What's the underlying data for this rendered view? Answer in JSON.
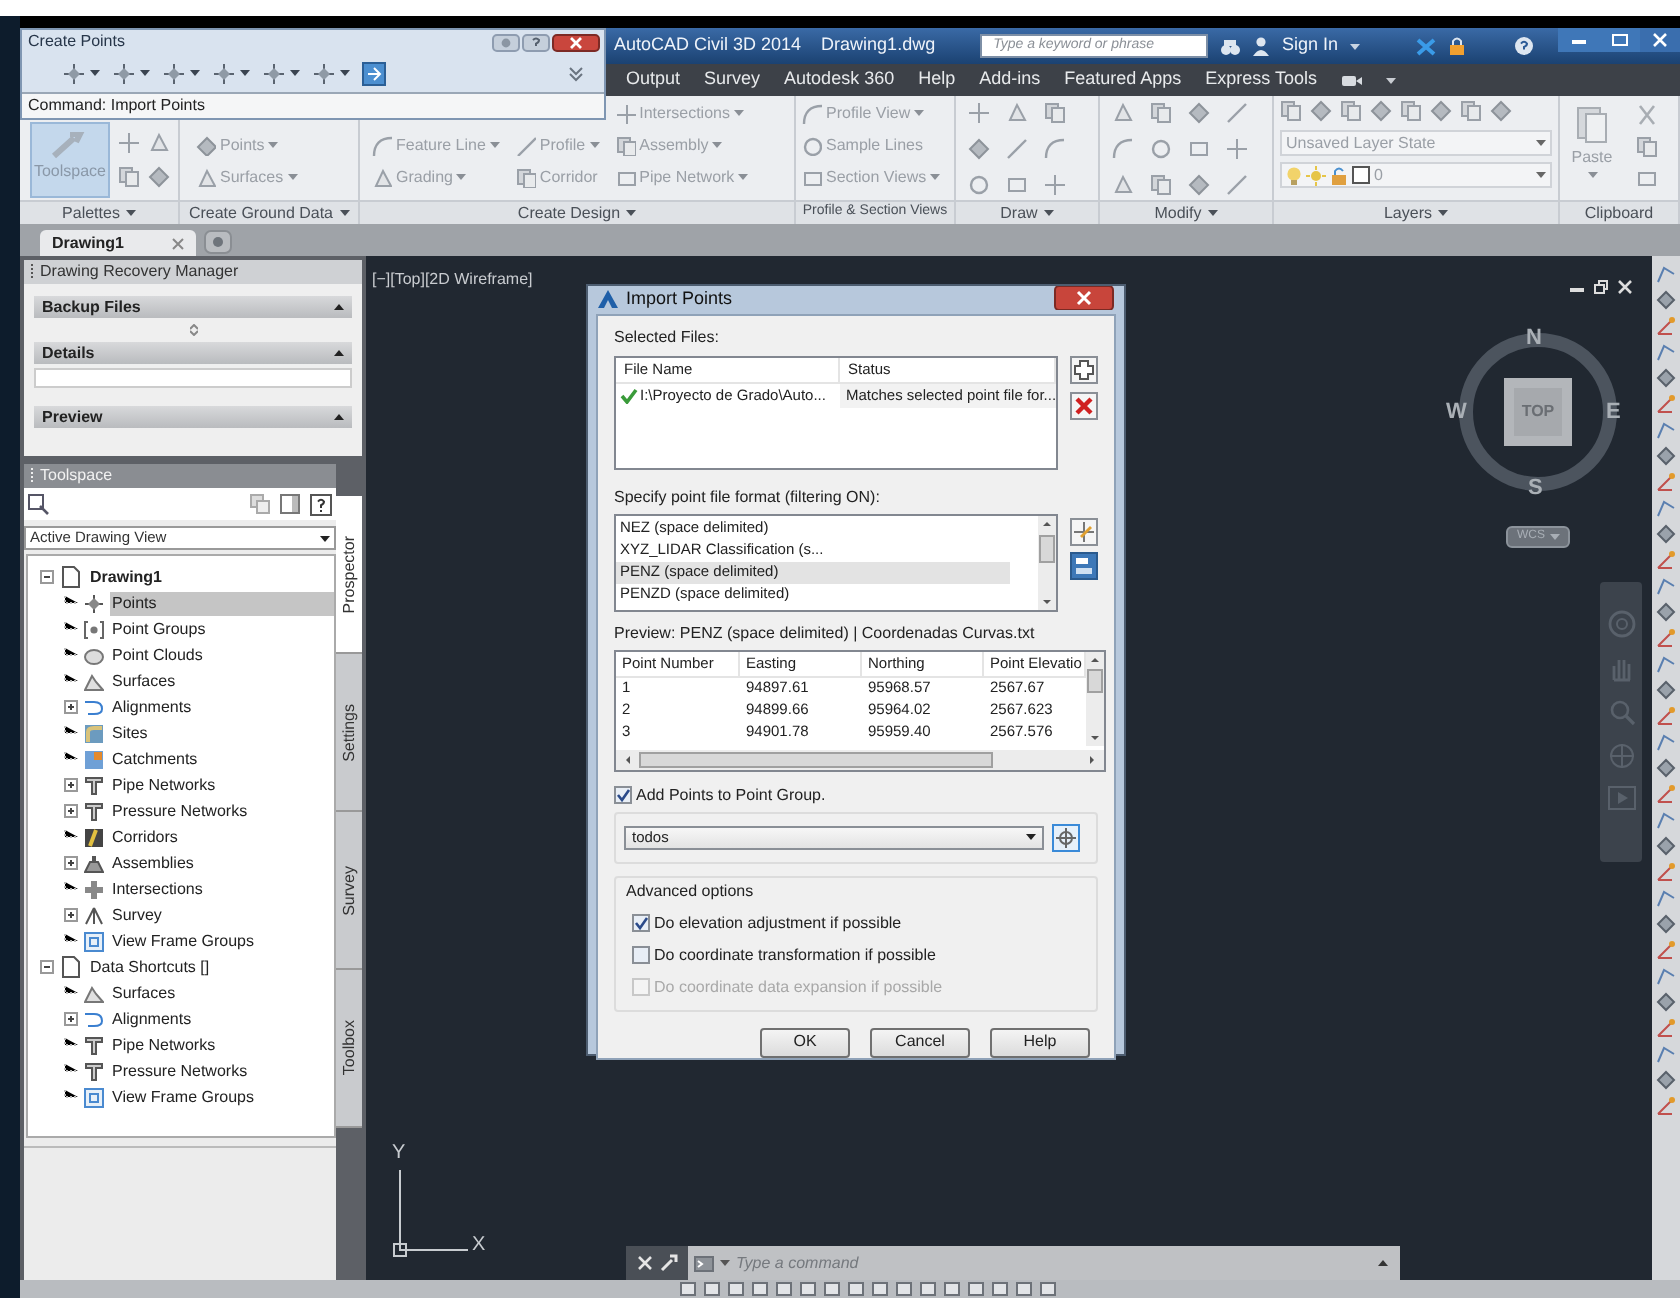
{
  "toolbar": {
    "title": "Create Points",
    "command": "Command: Import Points"
  },
  "title_bar": {
    "product": "AutoCAD Civil 3D 2014",
    "file": "Drawing1.dwg"
  },
  "search": {
    "placeholder": "Type a keyword or phrase"
  },
  "account": {
    "label": "Sign In"
  },
  "ribbon_tabs": [
    "Output",
    "Survey",
    "Autodesk 360",
    "Help",
    "Add-ins",
    "Featured Apps",
    "Express Tools"
  ],
  "ribbon_panels": [
    {
      "title": "Palettes",
      "tools": [
        {
          "label": "Toolspace"
        }
      ]
    },
    {
      "title": "Create Ground Data",
      "tools": [
        {
          "label": "Points"
        },
        {
          "label": "Surfaces"
        }
      ]
    },
    {
      "title": "Create Design",
      "tools": [
        {
          "label": "Feature Line"
        },
        {
          "label": "Grading"
        },
        {
          "label": "Profile"
        },
        {
          "label": "Corridor"
        },
        {
          "label": "Intersections"
        },
        {
          "label": "Assembly"
        },
        {
          "label": "Pipe Network"
        }
      ]
    },
    {
      "title": "Profile & Section Views",
      "tools": [
        {
          "label": "Profile View"
        },
        {
          "label": "Sample Lines"
        },
        {
          "label": "Section Views"
        }
      ]
    },
    {
      "title": "Draw"
    },
    {
      "title": "Modify"
    },
    {
      "title": "Layers",
      "tools": [
        {
          "label": "Unsaved Layer State"
        },
        {
          "label": "0"
        }
      ]
    },
    {
      "title": "Clipboard",
      "tools": [
        {
          "label": "Paste"
        }
      ]
    }
  ],
  "doc_tabs": [
    {
      "label": "Drawing1",
      "selected": true
    }
  ],
  "recovery": {
    "title": "Drawing Recovery Manager",
    "sections": [
      "Backup Files",
      "Details",
      "Preview"
    ]
  },
  "toolspace": {
    "title": "Toolspace",
    "view": "Active Drawing View",
    "tree": [
      {
        "label": "Drawing1",
        "expanded": true,
        "selected": false,
        "children": [
          {
            "label": "Points",
            "selected": true
          },
          {
            "label": "Point Groups",
            "selected": false
          },
          {
            "label": "Point Clouds",
            "selected": false
          },
          {
            "label": "Surfaces",
            "selected": false
          },
          {
            "label": "Alignments",
            "selected": false,
            "expanded": false
          },
          {
            "label": "Sites",
            "selected": false
          },
          {
            "label": "Catchments",
            "selected": false
          },
          {
            "label": "Pipe Networks",
            "selected": false,
            "expanded": false
          },
          {
            "label": "Pressure Networks",
            "selected": false,
            "expanded": false
          },
          {
            "label": "Corridors",
            "selected": false
          },
          {
            "label": "Assemblies",
            "selected": false,
            "expanded": false
          },
          {
            "label": "Intersections",
            "selected": false
          },
          {
            "label": "Survey",
            "selected": false,
            "expanded": false
          },
          {
            "label": "View Frame Groups",
            "selected": false
          }
        ]
      },
      {
        "label": "Data Shortcuts []",
        "expanded": true,
        "selected": false,
        "children": [
          {
            "label": "Surfaces",
            "selected": false
          },
          {
            "label": "Alignments",
            "selected": false,
            "expanded": false
          },
          {
            "label": "Pipe Networks",
            "selected": false
          },
          {
            "label": "Pressure Networks",
            "selected": false
          },
          {
            "label": "View Frame Groups",
            "selected": false
          }
        ]
      }
    ],
    "side_tabs": [
      {
        "label": "Prospector",
        "selected": true
      },
      {
        "label": "Settings",
        "selected": false
      },
      {
        "label": "Survey",
        "selected": false
      },
      {
        "label": "Toolbox",
        "selected": false
      }
    ]
  },
  "viewport": {
    "label": "[−][Top][2D Wireframe]",
    "compass": {
      "top": "TOP",
      "north": "N",
      "south": "S",
      "east": "E",
      "west": "W"
    },
    "ucs_menu": "WCS",
    "axis_x": "X",
    "axis_y": "Y"
  },
  "command_line": {
    "placeholder": "Type a command"
  },
  "dialog": {
    "title": "Import Points",
    "selected_files": {
      "label": "Selected Files:",
      "columns": [
        "File Name",
        "Status"
      ],
      "rows": [
        {
          "file": "I:\\Proyecto de Grado\\Auto...",
          "status": "Matches selected point file for..."
        }
      ]
    },
    "format": {
      "label": "Specify point file format (filtering ON):",
      "items": [
        {
          "label": "NEZ (space delimited)",
          "selected": false
        },
        {
          "label": "XYZ_LIDAR Classification (s...",
          "selected": false
        },
        {
          "label": "PENZ (space delimited)",
          "selected": true
        },
        {
          "label": "PENZD (space delimited)",
          "selected": false
        }
      ]
    },
    "preview": {
      "label": "Preview: PENZ (space delimited) | Coordenadas Curvas.txt",
      "columns": [
        "Point Number",
        "Easting",
        "Northing",
        "Point Elevatio"
      ],
      "rows": [
        [
          "1",
          "94897.61",
          "95968.57",
          "2567.67"
        ],
        [
          "2",
          "94899.66",
          "95964.02",
          "2567.623"
        ],
        [
          "3",
          "94901.78",
          "95959.40",
          "2567.576"
        ]
      ]
    },
    "add_to_group": {
      "label": "Add Points to Point Group.",
      "checked": true
    },
    "group": {
      "value": "todos"
    },
    "advanced": {
      "title": "Advanced options",
      "options": [
        {
          "label": "Do elevation adjustment if possible",
          "checked": true,
          "disabled": false
        },
        {
          "label": "Do coordinate transformation if possible",
          "checked": false,
          "disabled": false
        },
        {
          "label": "Do coordinate data expansion if possible",
          "checked": false,
          "disabled": true
        }
      ]
    },
    "buttons": [
      "OK",
      "Cancel",
      "Help"
    ]
  }
}
